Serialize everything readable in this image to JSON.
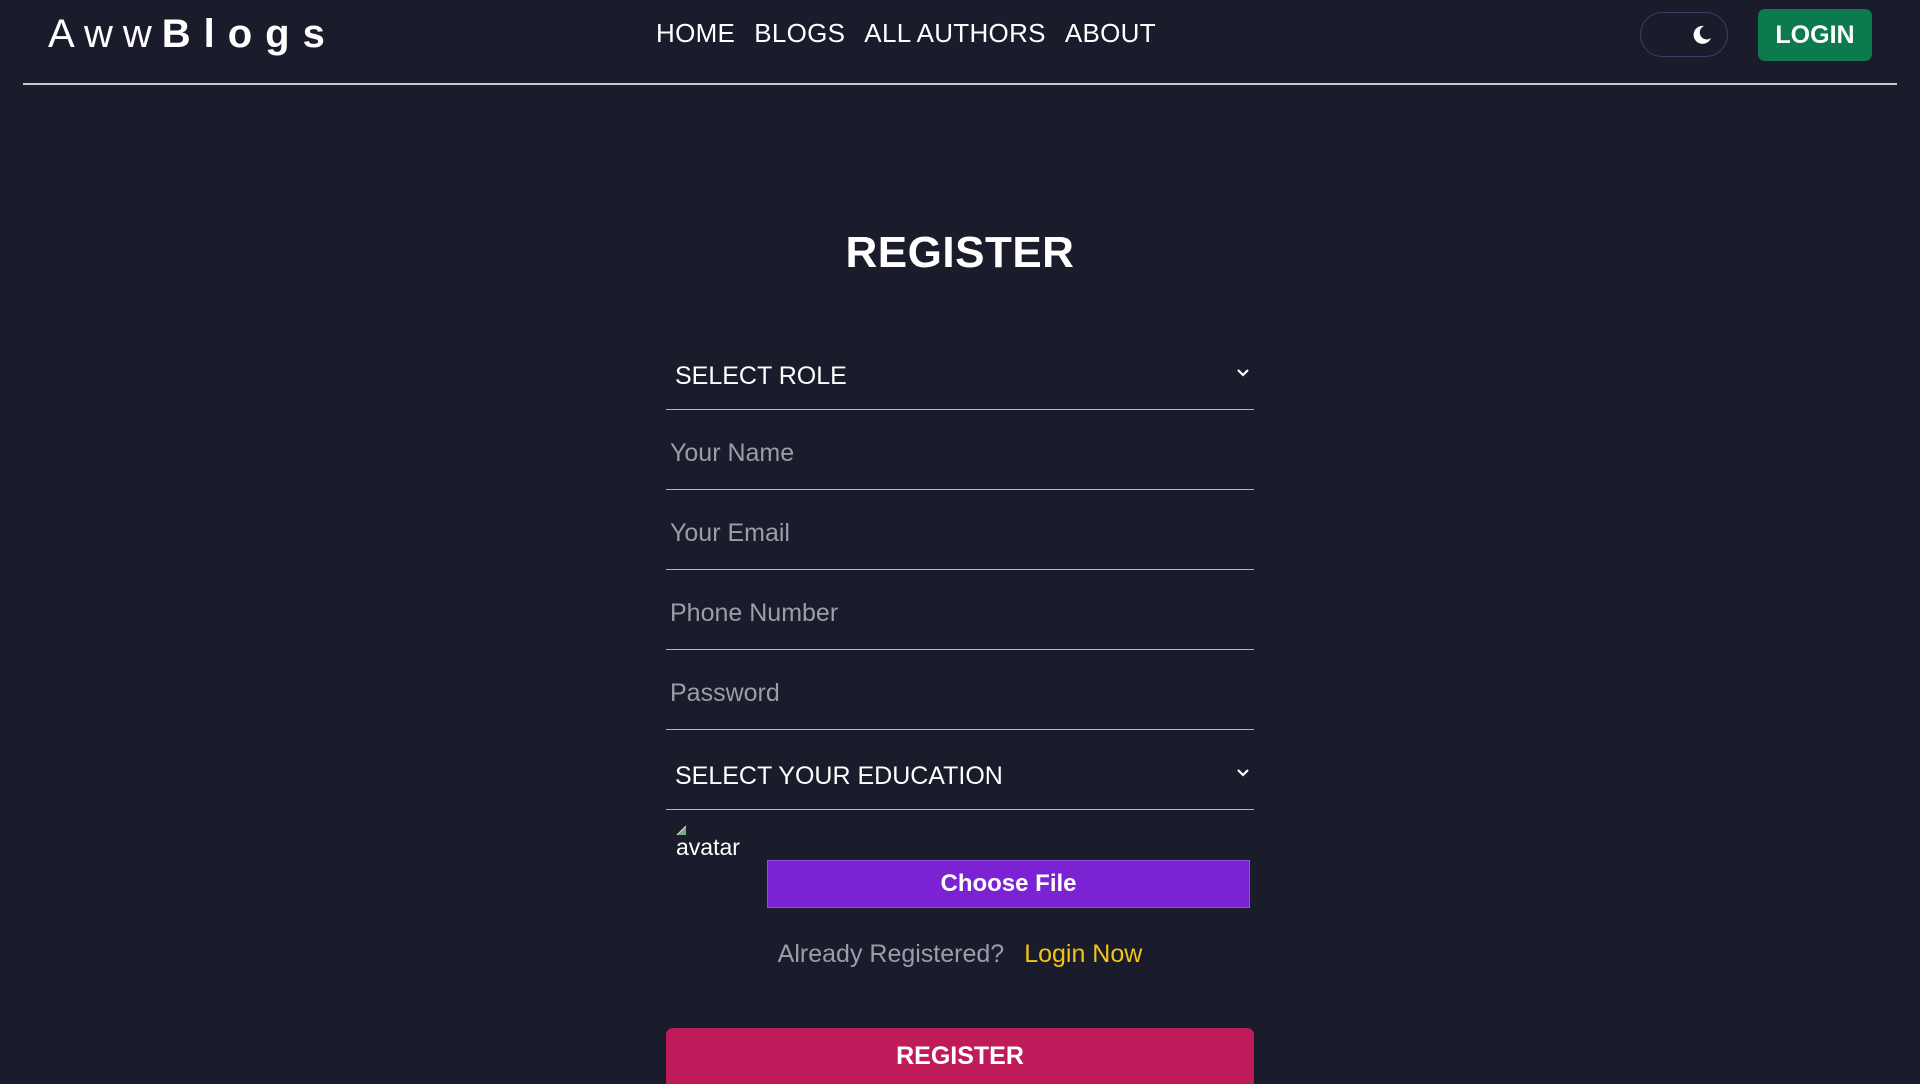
{
  "nav": {
    "logo_light": "Aww",
    "logo_bold": "Blogs",
    "links": [
      "HOME",
      "BLOGS",
      "ALL AUTHORS",
      "ABOUT"
    ],
    "theme_icon": "moon-icon",
    "login_label": "LOGIN"
  },
  "page": {
    "title": "REGISTER"
  },
  "form": {
    "role_select": {
      "selected": "SELECT ROLE"
    },
    "name_placeholder": "Your Name",
    "email_placeholder": "Your Email",
    "phone_placeholder": "Phone Number",
    "password_placeholder": "Password",
    "education_select": {
      "selected": "SELECT YOUR EDUCATION"
    },
    "avatar_alt": "avatar",
    "file_button_label": "Choose File",
    "already_text": "Already Registered?",
    "login_link": "Login Now",
    "submit_label": "REGISTER"
  },
  "colors": {
    "background": "#1a1b2b",
    "login_button": "#0d7a4e",
    "file_button": "#7b22d3",
    "link": "#f0c419",
    "register_button": "#bf1a5a"
  }
}
